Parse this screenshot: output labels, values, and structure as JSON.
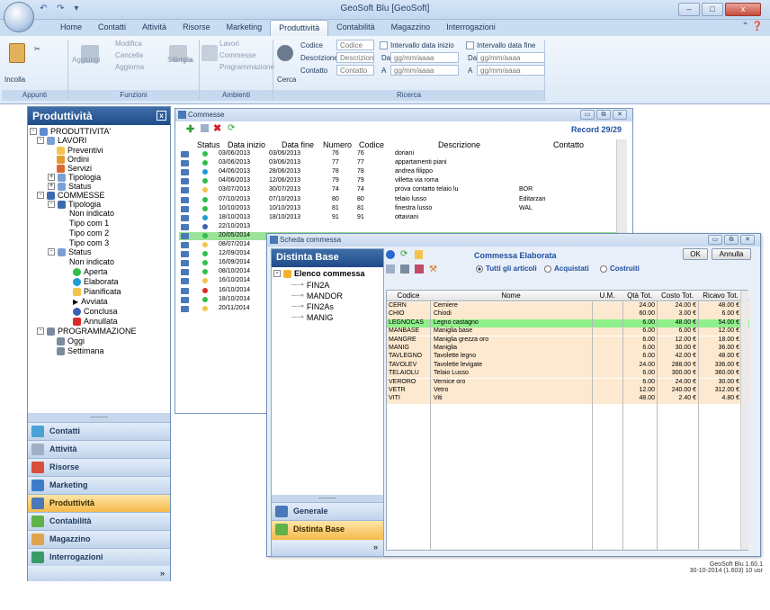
{
  "titlebar": {
    "title": "GeoSoft Blu [GeoSoft]",
    "min": "–",
    "max": "□",
    "close": "x"
  },
  "tabs": [
    "Home",
    "Contatti",
    "Attività",
    "Risorse",
    "Marketing",
    "Produttività",
    "Contabilità",
    "Magazzino",
    "Interrogazioni"
  ],
  "ribbon": {
    "appunti": {
      "incolla": "Incolla",
      "label": "Appunti"
    },
    "funzioni": {
      "aggiungi": "Aggiungi",
      "modifica": "Modifica",
      "cancella": "Cancella",
      "aggiorna": "Aggiorna",
      "stampa": "Stampa",
      "label": "Funzioni"
    },
    "ambienti": {
      "griglia": "Griglia",
      "lavori": "Lavori",
      "commesse": "Commesse",
      "programmazione": "Programmazione",
      "label": "Ambienti"
    },
    "ricerca": {
      "cerca": "Cerca",
      "codice_label": "Codice",
      "codice_ph": "Codice",
      "descrizione_label": "Descrizione",
      "descrizione_ph": "Descrizione",
      "contatto_label": "Contatto",
      "contatto_ph": "Contatto",
      "int_inizio": "Intervallo data inizio",
      "int_fine": "Intervallo data fine",
      "da": "Da",
      "a": "A",
      "date_ph": "gg/mm/aaaa",
      "label": "Ricerca"
    }
  },
  "leftpanel": {
    "title": "Produttività",
    "tree": [
      "PRODUTTIVITA'",
      "LAVORI",
      "Preventivi",
      "Ordini",
      "Servizi",
      "Tipologia",
      "Status",
      "COMMESSE",
      "Tipologia",
      "Non indicato",
      "Tipo com 1",
      "Tipo com 2",
      "Tipo com 3",
      "Status",
      "Non indicato",
      "Aperta",
      "Elaborata",
      "Pianificata",
      "Avviata",
      "Conclusa",
      "Annullata",
      "PROGRAMMAZIONE",
      "Oggi",
      "Settimana"
    ],
    "dots": "..........",
    "nav": [
      "Contatti",
      "Attività",
      "Risorse",
      "Marketing",
      "Produttività",
      "Contabilità",
      "Magazzino",
      "Interrogazioni"
    ],
    "more": "»"
  },
  "commesse": {
    "title": "Commesse",
    "record": "Record 29/29",
    "cols": [
      "Status",
      "Data inizio",
      "Data fine",
      "Numero",
      "Codice",
      "Descrizione",
      "Contatto"
    ],
    "rows": [
      {
        "d1": "03/06/2013",
        "d2": "03/06/2013",
        "n": "76",
        "c": "76",
        "desc": "doriani",
        "cont": ""
      },
      {
        "d1": "03/06/2013",
        "d2": "03/06/2013",
        "n": "77",
        "c": "77",
        "desc": "appartamenti piani",
        "cont": ""
      },
      {
        "d1": "04/06/2013",
        "d2": "28/06/2013",
        "n": "78",
        "c": "78",
        "desc": "andrea filippo",
        "cont": ""
      },
      {
        "d1": "04/06/2013",
        "d2": "12/06/2013",
        "n": "79",
        "c": "79",
        "desc": "villetta via roma",
        "cont": ""
      },
      {
        "d1": "03/07/2013",
        "d2": "30/07/2013",
        "n": "74",
        "c": "74",
        "desc": "prova contatto telaio lu",
        "cont": "BOR"
      },
      {
        "d1": "07/10/2013",
        "d2": "07/10/2013",
        "n": "80",
        "c": "80",
        "desc": "telaio lusso",
        "cont": "Editarzan"
      },
      {
        "d1": "10/10/2013",
        "d2": "10/10/2013",
        "n": "81",
        "c": "81",
        "desc": "finestra lusso",
        "cont": "WAL"
      },
      {
        "d1": "18/10/2013",
        "d2": "18/10/2013",
        "n": "91",
        "c": "91",
        "desc": "ottaviani",
        "cont": ""
      },
      {
        "d1": "22/10/2013",
        "d2": "",
        "n": "",
        "c": "",
        "desc": "",
        "cont": ""
      },
      {
        "d1": "20/05/2014",
        "d2": "",
        "n": "",
        "c": "",
        "desc": "",
        "cont": ""
      },
      {
        "d1": "08/07/2014",
        "d2": "",
        "n": "",
        "c": "",
        "desc": "",
        "cont": ""
      },
      {
        "d1": "12/09/2014",
        "d2": "",
        "n": "",
        "c": "",
        "desc": "",
        "cont": ""
      },
      {
        "d1": "16/09/2014",
        "d2": "",
        "n": "",
        "c": "",
        "desc": "",
        "cont": ""
      },
      {
        "d1": "08/10/2014",
        "d2": "",
        "n": "",
        "c": "",
        "desc": "",
        "cont": ""
      },
      {
        "d1": "16/10/2014",
        "d2": "",
        "n": "",
        "c": "",
        "desc": "",
        "cont": ""
      },
      {
        "d1": "16/10/2014",
        "d2": "",
        "n": "",
        "c": "",
        "desc": "",
        "cont": ""
      },
      {
        "d1": "18/10/2014",
        "d2": "",
        "n": "",
        "c": "",
        "desc": "",
        "cont": ""
      },
      {
        "d1": "20/11/2014",
        "d2": "",
        "n": "",
        "c": "",
        "desc": "",
        "cont": ""
      }
    ]
  },
  "scheda": {
    "title": "Scheda commessa",
    "db_title": "Distinta Base",
    "tree_root": "Elenco commessa",
    "tree": [
      "FIN2A",
      "MANDOR",
      "FIN2As",
      "MANIG"
    ],
    "status": "Commessa Elaborata",
    "ok": "OK",
    "annulla": "Annulla",
    "radio": [
      "Tutti gli articoli",
      "Acquistati",
      "Costruiti"
    ],
    "nav": [
      "Generale",
      "Distinta Base"
    ],
    "dots": "..........",
    "more": "»",
    "cols": [
      "Codice",
      "Nome",
      "U.M.",
      "Qtà Tot.",
      "Costo Tot.",
      "Ricavo Tot."
    ],
    "items": [
      {
        "c": "CERN",
        "n": "Cerniere",
        "q": "24.00",
        "co": "24.00 €",
        "r": "48.00 €"
      },
      {
        "c": "CHIO",
        "n": "Chiodi",
        "q": "60.00",
        "co": "3.00 €",
        "r": "6.00 €"
      },
      {
        "c": "LEGNOCAS",
        "n": "Legno castagno",
        "q": "6.00",
        "co": "48.00 €",
        "r": "54.00 €"
      },
      {
        "c": "MANBASE",
        "n": "Maniglia base",
        "q": "6.00",
        "co": "6.00 €",
        "r": "12.00 €"
      },
      {
        "c": "MANGRE",
        "n": "Maniglia grezza oro",
        "q": "6.00",
        "co": "12.00 €",
        "r": "18.00 €"
      },
      {
        "c": "MANIG",
        "n": "Maniglia",
        "q": "6.00",
        "co": "30.00 €",
        "r": "36.00 €"
      },
      {
        "c": "TAVLEGNO",
        "n": "Tavolette legno",
        "q": "6.00",
        "co": "42.00 €",
        "r": "48.00 €"
      },
      {
        "c": "TAVOLEV",
        "n": "Tavolette levigate",
        "q": "24.00",
        "co": "288.00 €",
        "r": "336.00 €"
      },
      {
        "c": "TELAIOLU",
        "n": "Telaio Lusso",
        "q": "6.00",
        "co": "300.00 €",
        "r": "360.00 €"
      },
      {
        "c": "VERORO",
        "n": "Vernice oro",
        "q": "6.00",
        "co": "24.00 €",
        "r": "30.00 €"
      },
      {
        "c": "VETR",
        "n": "Vetro",
        "q": "12.00",
        "co": "240.00 €",
        "r": "312.00 €"
      },
      {
        "c": "VITI",
        "n": "Viti",
        "q": "48.00",
        "co": "2.40 €",
        "r": "4.80 €"
      }
    ]
  },
  "footer": {
    "line1": "GeoSoft Blu 1.60.1",
    "line2": "30-10-2014 (1.603) 10 usr"
  }
}
